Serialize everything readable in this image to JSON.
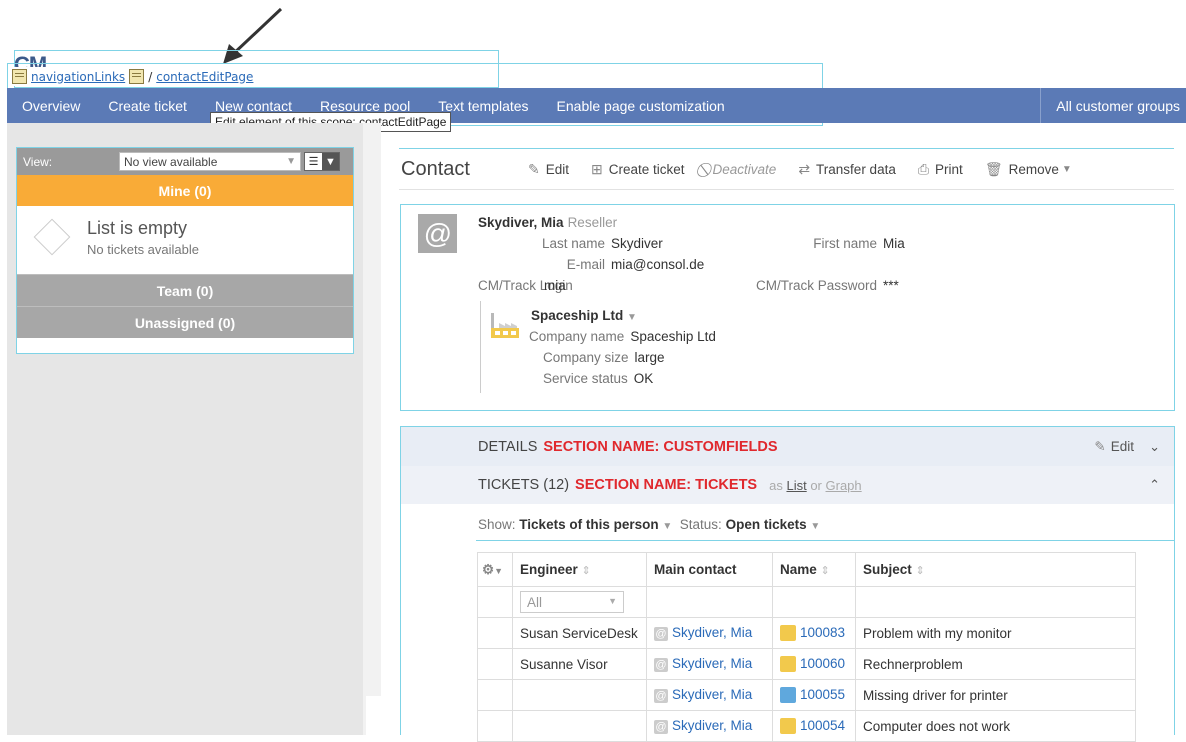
{
  "scope": {
    "logo_text": "CM",
    "crumb_link1": "navigationLinks",
    "crumb_sep": "/",
    "crumb_link2": "contactEditPage",
    "tooltip": "Edit element of this scope: contactEditPage"
  },
  "nav": {
    "items": [
      "Overview",
      "Create ticket",
      "New contact",
      "Resource pool",
      "Text templates",
      "Enable page customization"
    ],
    "right": "All customer groups"
  },
  "left": {
    "view_label": "View:",
    "view_value": "No view available",
    "tabs": {
      "mine": "Mine (0)",
      "team": "Team (0)",
      "unassigned": "Unassigned (0)"
    },
    "empty_title": "List is empty",
    "empty_sub": "No tickets available"
  },
  "contact": {
    "title": "Contact",
    "toolbar": {
      "edit": "Edit",
      "create_ticket": "Create ticket",
      "deactivate": "Deactivate",
      "transfer": "Transfer data",
      "print": "Print",
      "remove": "Remove"
    },
    "name": "Skydiver, Mia",
    "role": "Reseller",
    "fields": {
      "last_name_label": "Last name",
      "last_name": "Skydiver",
      "first_name_label": "First name",
      "first_name": "Mia",
      "email_label": "E-mail",
      "email": "mia@consol.de",
      "login_label": "CM/Track Login",
      "login": "mia",
      "password_label": "CM/Track Password",
      "password": "***"
    },
    "company": {
      "name": "Spaceship Ltd",
      "company_name_label": "Company name",
      "company_name": "Spaceship Ltd",
      "size_label": "Company size",
      "size": "large",
      "service_label": "Service status",
      "service": "OK"
    }
  },
  "sections": {
    "details": "DETAILS",
    "details_red": "SECTION NAME: CUSTOMFIELDS",
    "details_edit": "Edit",
    "tickets": "TICKETS (12)",
    "tickets_red": "SECTION NAME: TICKETS",
    "as": "as",
    "list": "List",
    "or": "or",
    "graph": "Graph"
  },
  "tickets": {
    "show_label": "Show:",
    "show_value": "Tickets of this person",
    "status_label": "Status:",
    "status_value": "Open tickets",
    "headers": {
      "engineer": "Engineer",
      "main_contact": "Main contact",
      "name": "Name",
      "subject": "Subject"
    },
    "filter_all": "All",
    "rows": [
      {
        "engineer": "Susan ServiceDesk",
        "contact": "Skydiver, Mia",
        "id": "100083",
        "subject": "Problem with my monitor",
        "color": "#f2c94c"
      },
      {
        "engineer": "Susanne Visor",
        "contact": "Skydiver, Mia",
        "id": "100060",
        "subject": "Rechnerproblem",
        "color": "#f2c94c"
      },
      {
        "engineer": "",
        "contact": "Skydiver, Mia",
        "id": "100055",
        "subject": "Missing driver for printer",
        "color": "#5fa8dd"
      },
      {
        "engineer": "",
        "contact": "Skydiver, Mia",
        "id": "100054",
        "subject": "Computer does not work",
        "color": "#f2c94c"
      }
    ]
  }
}
